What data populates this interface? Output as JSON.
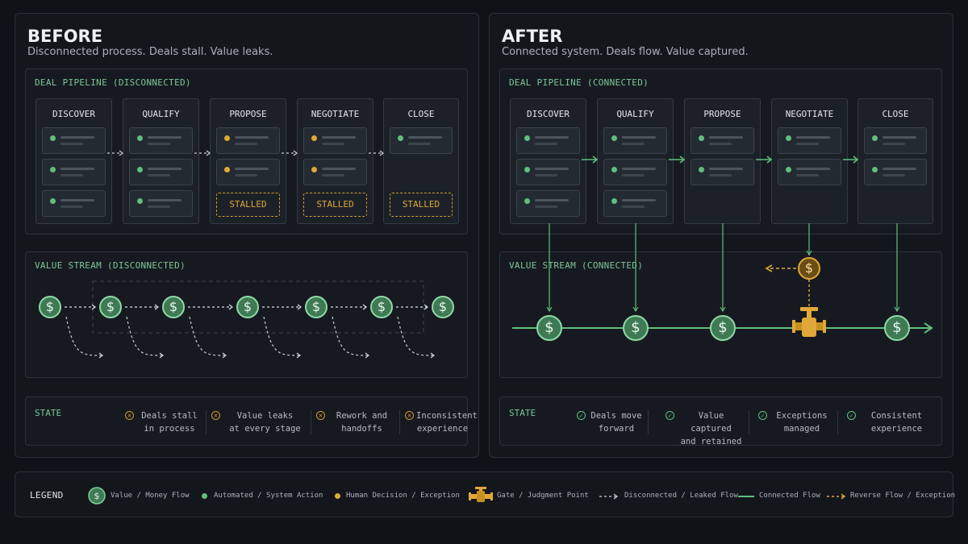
{
  "before": {
    "title": "BEFORE",
    "subtitle": "Disconnected process. Deals stall. Value leaks.",
    "pipeline_label": "DEAL PIPELINE (DISCONNECTED)",
    "stream_label": "VALUE STREAM (DISCONNECTED)",
    "stages": [
      {
        "name": "DISCOVER",
        "cards": [
          "automated",
          "automated",
          "automated"
        ],
        "stalled": ""
      },
      {
        "name": "QUALIFY",
        "cards": [
          "automated",
          "automated",
          "automated"
        ],
        "stalled": ""
      },
      {
        "name": "PROPOSE",
        "cards": [
          "human",
          "human"
        ],
        "stalled": "STALLED"
      },
      {
        "name": "NEGOTIATE",
        "cards": [
          "human",
          "human"
        ],
        "stalled": "STALLED"
      },
      {
        "name": "CLOSE",
        "cards": [
          "automated"
        ],
        "stalled": "STALLED"
      }
    ],
    "state_label": "STATE",
    "states": [
      {
        "l1": "Deals stall",
        "l2": "in process"
      },
      {
        "l1": "Value leaks",
        "l2": "at every stage"
      },
      {
        "l1": "Rework and",
        "l2": "handoffs"
      },
      {
        "l1": "Inconsistent",
        "l2": "experience"
      }
    ]
  },
  "after": {
    "title": "AFTER",
    "subtitle": "Connected system. Deals flow. Value captured.",
    "pipeline_label": "DEAL PIPELINE (CONNECTED)",
    "stream_label": "VALUE STREAM (CONNECTED)",
    "stages": [
      {
        "name": "DISCOVER",
        "cards": [
          "automated",
          "automated",
          "automated"
        ]
      },
      {
        "name": "QUALIFY",
        "cards": [
          "automated",
          "automated",
          "automated"
        ]
      },
      {
        "name": "PROPOSE",
        "cards": [
          "automated",
          "automated"
        ]
      },
      {
        "name": "NEGOTIATE",
        "cards": [
          "automated",
          "automated"
        ]
      },
      {
        "name": "CLOSE",
        "cards": [
          "automated",
          "automated"
        ]
      }
    ],
    "state_label": "STATE",
    "states": [
      {
        "l1": "Deals move",
        "l2": "forward"
      },
      {
        "l1": "Value captured",
        "l2": "and retained"
      },
      {
        "l1": "Exceptions",
        "l2": "managed"
      },
      {
        "l1": "Consistent",
        "l2": "experience"
      }
    ]
  },
  "legend": {
    "title": "LEGEND",
    "items": [
      "Value / Money Flow",
      "Automated / System Action",
      "Human Decision / Exception",
      "Gate / Judgment Point",
      "Disconnected / Leaked Flow",
      "Connected Flow",
      "Reverse Flow / Exception"
    ]
  },
  "symbols": {
    "coin": "$",
    "fail_icon": "×",
    "ok_icon": "✓"
  },
  "colors": {
    "green": "#5fbf7f",
    "amber": "#e0a838",
    "background": "#0f1216",
    "panel": "#13171c"
  }
}
